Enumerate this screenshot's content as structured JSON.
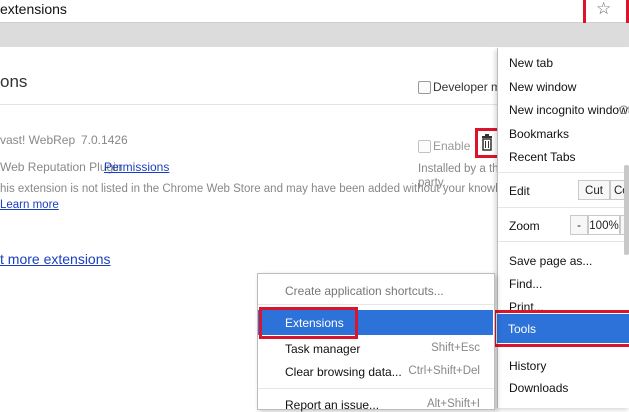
{
  "address_bar": {
    "text": "extensions"
  },
  "page": {
    "title": "ons",
    "developer_mode_label": "Developer mode",
    "extension": {
      "name": "vast! WebRep",
      "version": "7.0.1426",
      "description": "Web Reputation Plugin",
      "permissions_link": "Permissions",
      "warning": "his extension is not listed in the Chrome Web Store and may have been added without your knowledge.",
      "learn_more": "Learn more",
      "enable_label": "Enable",
      "installed_by_line1": "Installed by a third",
      "installed_by_line2": "party."
    },
    "more_extensions_link": "t more extensions"
  },
  "chrome_menu": {
    "items": {
      "new_tab": "New tab",
      "new_window": "New window",
      "new_incognito": "New incognito window",
      "new_incognito_shortcut": "Ctr",
      "bookmarks": "Bookmarks",
      "recent_tabs": "Recent Tabs",
      "edit": "Edit",
      "cut": "Cut",
      "copy": "Cop",
      "zoom": "Zoom",
      "zoom_minus": "-",
      "zoom_level": "100%",
      "zoom_plus": "+",
      "save_page": "Save page as...",
      "find": "Find...",
      "print": "Print...",
      "tools": "Tools",
      "history": "History",
      "downloads": "Downloads"
    }
  },
  "tools_submenu": {
    "create_shortcuts": "Create application shortcuts...",
    "extensions": "Extensions",
    "task_manager": "Task manager",
    "task_manager_shortcut": "Shift+Esc",
    "clear_browsing": "Clear browsing data...",
    "clear_browsing_shortcut": "Ctrl+Shift+Del",
    "report_issue": "Report an issue...",
    "report_issue_shortcut": "Alt+Shift+I"
  },
  "colors": {
    "highlight": "#2d72d8",
    "annotation_red": "#d9142b",
    "link": "#1a3fbf"
  }
}
